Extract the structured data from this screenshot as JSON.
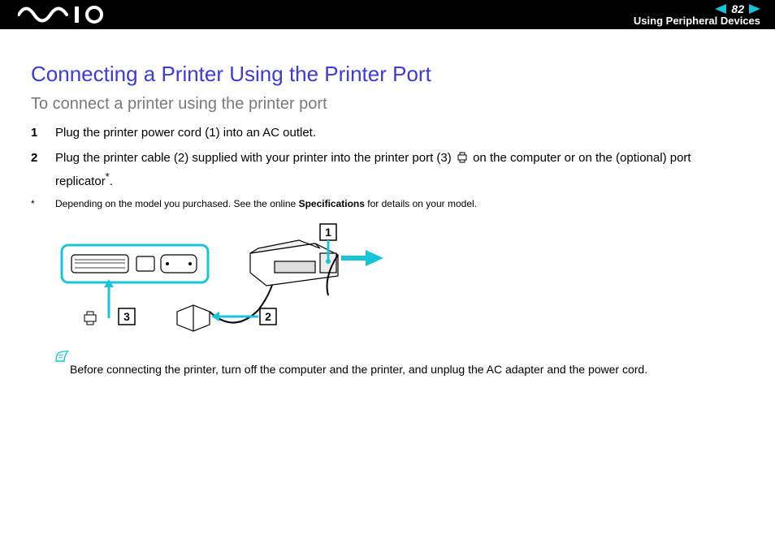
{
  "header": {
    "page_number": "82",
    "section": "Using Peripheral Devices"
  },
  "title": "Connecting a Printer Using the Printer Port",
  "subtitle": "To connect a printer using the printer port",
  "steps": [
    {
      "num": "1",
      "text": "Plug the printer power cord (1) into an AC outlet."
    },
    {
      "num": "2",
      "text_before": "Plug the printer cable (2) supplied with your printer into the printer port (3) ",
      "text_after": " on the computer or on the (optional) port replicator",
      "text_tail": "."
    }
  ],
  "footnote": {
    "mark": "*",
    "text_before": "Depending on the model you purchased. See the online ",
    "bold": "Specifications",
    "text_after": " for details on your model."
  },
  "diagram": {
    "labels": {
      "one": "1",
      "two": "2",
      "three": "3"
    }
  },
  "note": "Before connecting the printer, turn off the computer and the printer, and unplug the AC adapter and the power cord."
}
